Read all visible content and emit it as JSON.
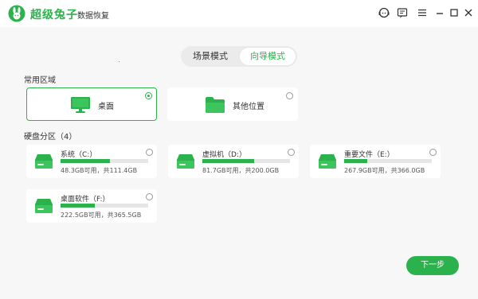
{
  "app": {
    "brand": "超级兔子",
    "product": "数据恢复"
  },
  "mode_tabs": [
    {
      "label": "场景模式",
      "active": false
    },
    {
      "label": "向导模式",
      "active": true
    }
  ],
  "common_areas": {
    "title": "常用区域",
    "items": [
      {
        "label": "桌面",
        "icon": "desktop-monitor-icon",
        "selected": true
      },
      {
        "label": "其他位置",
        "icon": "folder-icon",
        "selected": false
      }
    ]
  },
  "partitions": {
    "title": "硬盘分区（4）",
    "drives": [
      {
        "name": "系统（C:）",
        "info": "48.3GB可用，共111.4GB",
        "used_fraction": 0.566
      },
      {
        "name": "虚拟机（D:）",
        "info": "81.7GB可用，共200.0GB",
        "used_fraction": 0.59
      },
      {
        "name": "重要文件（E:）",
        "info": "267.9GB可用，共366.0GB",
        "used_fraction": 0.268
      },
      {
        "name": "桌面软件（F:）",
        "info": "222.5GB可用，共365.5GB",
        "used_fraction": 0.391
      }
    ]
  },
  "next_label": "下一步",
  "colors": {
    "accent": "#2bb24c",
    "background": "#f7f7f7",
    "card": "#ffffff",
    "bar_track": "#e6e6e6"
  }
}
